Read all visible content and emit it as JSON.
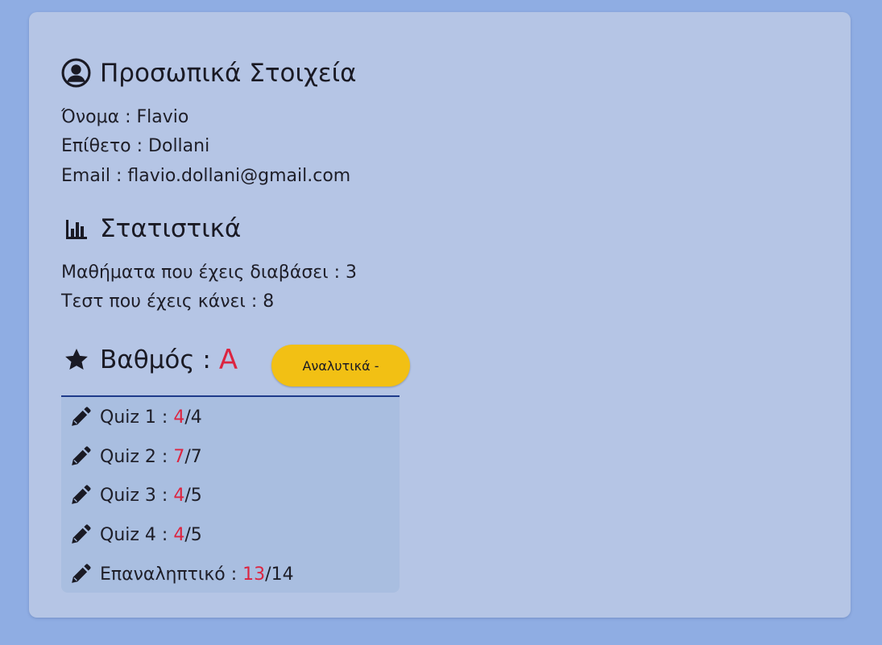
{
  "personal": {
    "title": "Προσωπικά Στοιχεία",
    "icon": "user-circle-icon",
    "name_line": "Όνομα : Flavio",
    "surname_line": "Επίθετο : Dollani",
    "email_line": "Email : flavio.dollani@gmail.com"
  },
  "stats": {
    "title": "Στατιστικά",
    "icon": "bar-chart-icon",
    "lessons_line": "Μαθήματα που έχεις διαβάσει : 3",
    "tests_line": "Τεστ που έχεις κάνει : 8"
  },
  "grade": {
    "label": "Βαθμός :",
    "value": "A",
    "icon": "star-icon",
    "details_button": "Αναλυτικά -"
  },
  "quizzes": [
    {
      "label": "Quiz 1 :",
      "score": "4",
      "total": "/4"
    },
    {
      "label": "Quiz 2 :",
      "score": "7",
      "total": "/7"
    },
    {
      "label": "Quiz 3 :",
      "score": "4",
      "total": "/5"
    },
    {
      "label": "Quiz 4 :",
      "score": "4",
      "total": "/5"
    },
    {
      "label": "Επαναληπτικό :",
      "score": "13",
      "total": "/14"
    }
  ],
  "colors": {
    "page_background": "#8fade3",
    "card_background": "#b5c5e5",
    "accent_red": "#dc2440",
    "button_yellow": "#f2c014",
    "panel_border": "#1e3a8a"
  }
}
